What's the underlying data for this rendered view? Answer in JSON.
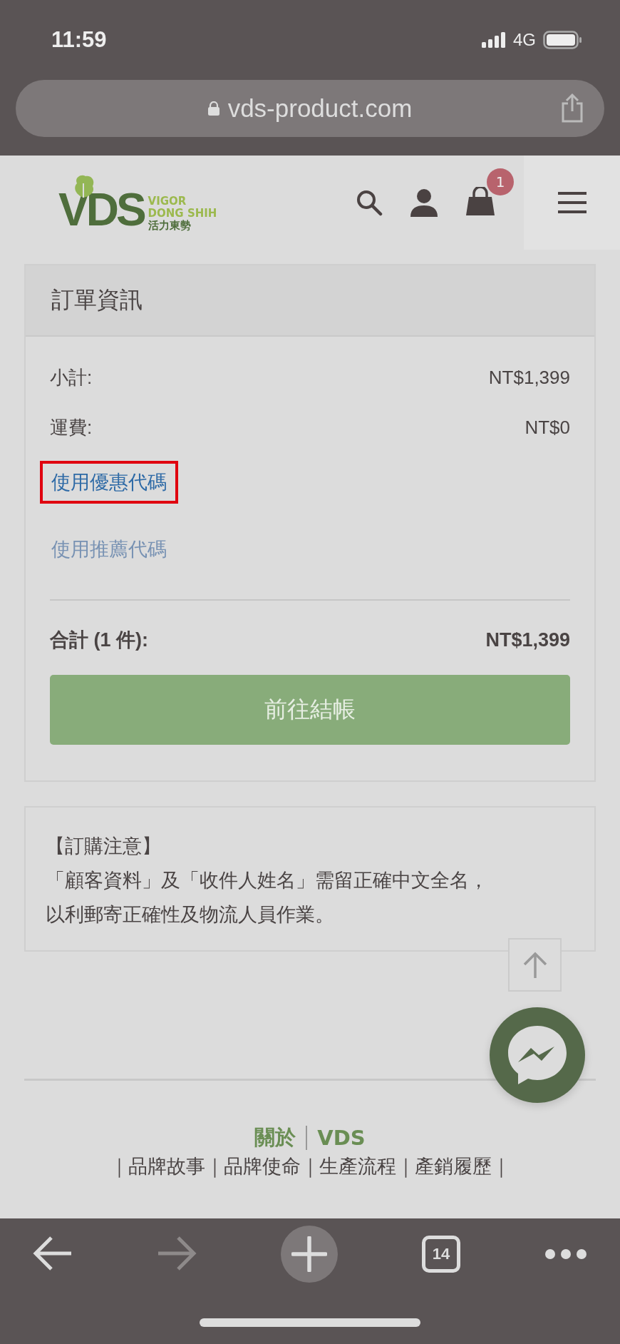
{
  "status_bar": {
    "time": "11:59",
    "network": "4G"
  },
  "address_bar": {
    "url": "vds-product.com"
  },
  "header": {
    "logo": {
      "mark": "VDS",
      "line_1": "VIGOR",
      "line_2": "DONG SHIH",
      "line_3": "活力東勢"
    },
    "cart_count": "1"
  },
  "order_summary": {
    "title": "訂單資訊",
    "rows": [
      {
        "label": "小計:",
        "value": "NT$1,399"
      },
      {
        "label": "運費:",
        "value": "NT$0"
      }
    ],
    "links": [
      {
        "label": "使用優惠代碼",
        "highlighted": true
      },
      {
        "label": "使用推薦代碼",
        "highlighted": false
      }
    ],
    "total": {
      "label": "合計 (1 件):",
      "value": "NT$1,399"
    },
    "checkout_button": "前往結帳"
  },
  "notice": {
    "title": "【訂購注意】",
    "lines": [
      "「顧客資料」及「收件人姓名」需留正確中文全名，",
      "以利郵寄正確性及物流人員作業。"
    ]
  },
  "footer": {
    "heading": {
      "left": "關於",
      "right": "VDS"
    },
    "links": "｜品牌故事｜品牌使命｜生產流程｜產銷履歷｜"
  },
  "toolbar": {
    "tab_count": "14"
  }
}
